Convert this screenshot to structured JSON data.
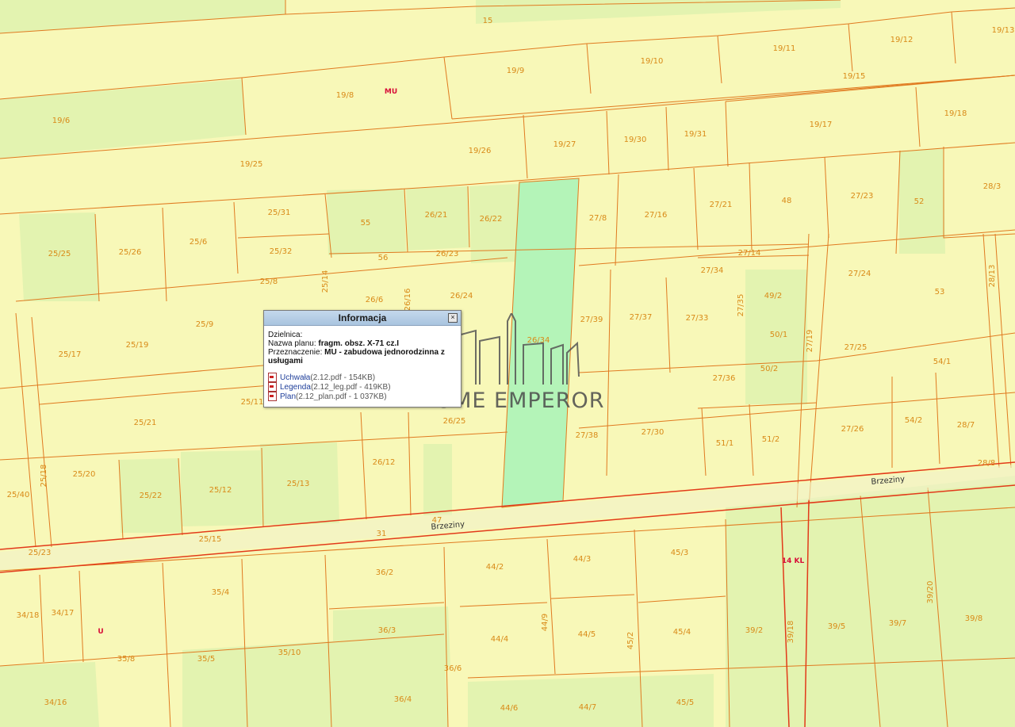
{
  "parcels": [
    {
      "label": "15"
    },
    {
      "label": "19/6"
    },
    {
      "label": "19/8"
    },
    {
      "label": "19/9"
    },
    {
      "label": "19/10"
    },
    {
      "label": "19/11"
    },
    {
      "label": "19/12"
    },
    {
      "label": "19/13"
    },
    {
      "label": "19/15"
    },
    {
      "label": "19/17"
    },
    {
      "label": "19/18"
    },
    {
      "label": "19/25"
    },
    {
      "label": "19/26"
    },
    {
      "label": "19/27"
    },
    {
      "label": "19/30"
    },
    {
      "label": "19/31"
    },
    {
      "label": "25/31"
    },
    {
      "label": "55"
    },
    {
      "label": "26/21"
    },
    {
      "label": "26/22"
    },
    {
      "label": "27/8"
    },
    {
      "label": "27/16"
    },
    {
      "label": "27/21"
    },
    {
      "label": "48"
    },
    {
      "label": "27/23"
    },
    {
      "label": "52"
    },
    {
      "label": "28/3"
    },
    {
      "label": "25/25"
    },
    {
      "label": "25/26"
    },
    {
      "label": "25/6"
    },
    {
      "label": "25/32"
    },
    {
      "label": "56"
    },
    {
      "label": "26/23"
    },
    {
      "label": "27/14"
    },
    {
      "label": "27/34"
    },
    {
      "label": "27/24"
    },
    {
      "label": "25/8"
    },
    {
      "label": "25/14"
    },
    {
      "label": "26/6"
    },
    {
      "label": "26/16"
    },
    {
      "label": "26/24"
    },
    {
      "label": "27/39"
    },
    {
      "label": "27/37"
    },
    {
      "label": "27/33"
    },
    {
      "label": "27/35"
    },
    {
      "label": "49/2"
    },
    {
      "label": "53"
    },
    {
      "label": "28/13"
    },
    {
      "label": "25/9"
    },
    {
      "label": "25/19"
    },
    {
      "label": "25/17"
    },
    {
      "label": "26/34"
    },
    {
      "label": "50/1"
    },
    {
      "label": "27/19"
    },
    {
      "label": "27/25"
    },
    {
      "label": "54/1"
    },
    {
      "label": "50/2"
    },
    {
      "label": "27/36"
    },
    {
      "label": "25/11"
    },
    {
      "label": "26/25"
    },
    {
      "label": "27/38"
    },
    {
      "label": "27/30"
    },
    {
      "label": "51/1"
    },
    {
      "label": "51/2"
    },
    {
      "label": "27/26"
    },
    {
      "label": "54/2"
    },
    {
      "label": "28/7"
    },
    {
      "label": "25/21"
    },
    {
      "label": "25/20"
    },
    {
      "label": "26/12"
    },
    {
      "label": "25/13"
    },
    {
      "label": "25/12"
    },
    {
      "label": "25/22"
    },
    {
      "label": "25/18"
    },
    {
      "label": "25/40"
    },
    {
      "label": "28/8"
    },
    {
      "label": "25/23"
    },
    {
      "label": "25/15"
    },
    {
      "label": "31"
    },
    {
      "label": "47"
    },
    {
      "label": "36/2"
    },
    {
      "label": "44/2"
    },
    {
      "label": "44/3"
    },
    {
      "label": "45/3"
    },
    {
      "label": "35/4"
    },
    {
      "label": "34/18"
    },
    {
      "label": "34/17"
    },
    {
      "label": "36/3"
    },
    {
      "label": "44/4"
    },
    {
      "label": "44/5"
    },
    {
      "label": "44/9"
    },
    {
      "label": "45/2"
    },
    {
      "label": "45/4"
    },
    {
      "label": "39/2"
    },
    {
      "label": "39/5"
    },
    {
      "label": "39/7"
    },
    {
      "label": "39/8"
    },
    {
      "label": "39/18"
    },
    {
      "label": "39/20"
    },
    {
      "label": "35/8"
    },
    {
      "label": "35/5"
    },
    {
      "label": "35/10"
    },
    {
      "label": "36/6"
    },
    {
      "label": "36/4"
    },
    {
      "label": "44/6"
    },
    {
      "label": "44/7"
    },
    {
      "label": "45/5"
    },
    {
      "label": "34/16"
    }
  ],
  "zones": [
    {
      "label": "MU"
    },
    {
      "label": "U"
    },
    {
      "label": "14 KL"
    }
  ],
  "streets": [
    {
      "label": "Brzeziny"
    },
    {
      "label": "Brzeziny"
    }
  ],
  "colors": {
    "parcel_fill": "#f8f8b8",
    "green_area": "#e3f3b0",
    "selected": "#b4f4b8",
    "boundary": "#e07a20",
    "road": "#e23a1a",
    "zone": "#d8103a"
  },
  "popup": {
    "title": "Informacja",
    "close_icon": "close-icon",
    "district_label": "Dzielnica:",
    "plan_name_label": "Nazwa planu:",
    "plan_name_value": "fragm. obsz. X-71 cz.I",
    "purpose_label": "Przeznaczenie:",
    "purpose_value": "MU - zabudowa jednorodzinna z usługami",
    "documents": [
      {
        "name": "Uchwała",
        "meta": "(2.12.pdf - 154KB)",
        "icon": "pdf-icon"
      },
      {
        "name": "Legenda",
        "meta": "(2.12_leg.pdf - 419KB)",
        "icon": "pdf-icon"
      },
      {
        "name": "Plan",
        "meta": "(2.12_plan.pdf - 1 037KB)",
        "icon": "pdf-icon"
      }
    ]
  },
  "watermark": {
    "text": "HOME EMPEROR"
  }
}
